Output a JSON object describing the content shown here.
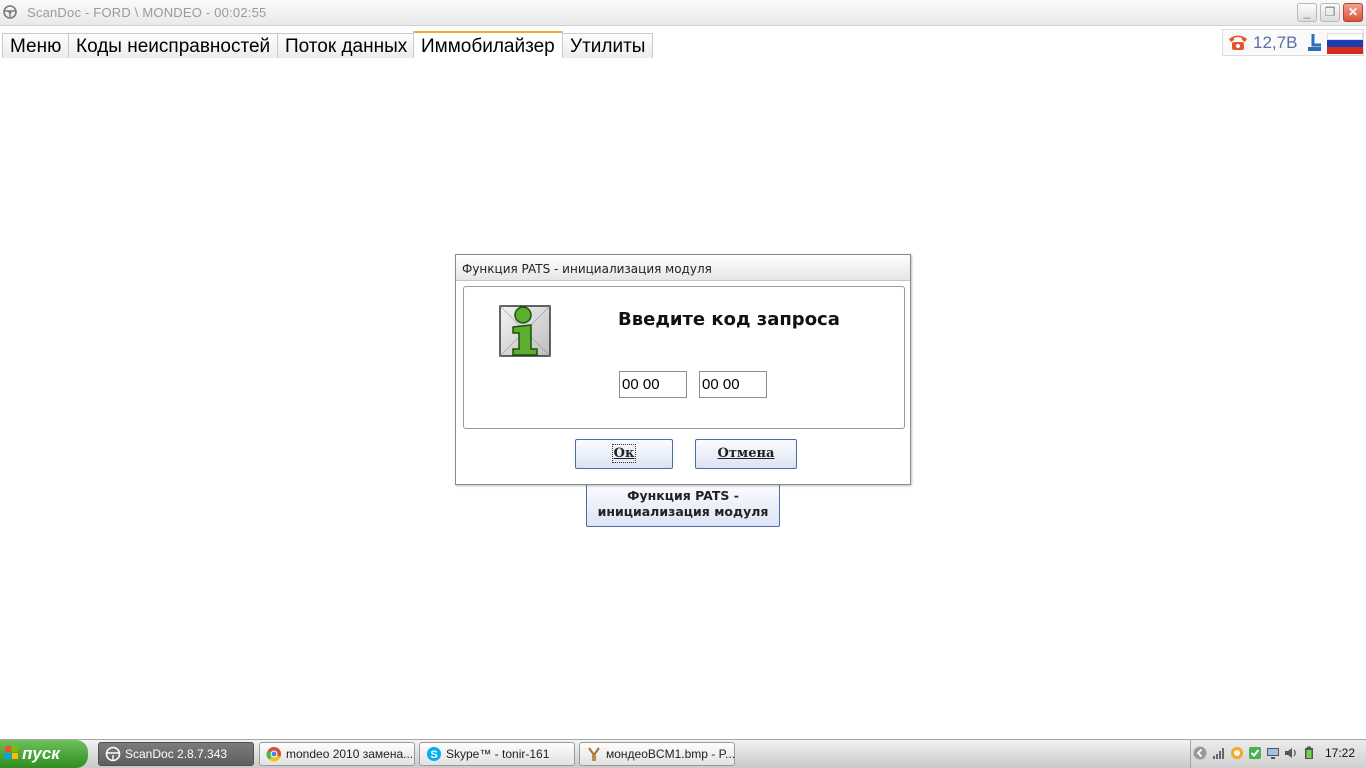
{
  "window": {
    "title": "ScanDoc - FORD \\ MONDEO - 00:02:55",
    "minimize": "_",
    "restore": "❐",
    "close": "✕"
  },
  "tabs": [
    {
      "label": "Меню"
    },
    {
      "label": "Коды неисправностей"
    },
    {
      "label": "Поток данных"
    },
    {
      "label": "Иммобилайзер",
      "active": true
    },
    {
      "label": "Утилиты"
    }
  ],
  "status": {
    "voltage": "12,7В",
    "icons": [
      "phone-icon",
      "plug-icon",
      "russian-flag-icon"
    ]
  },
  "background_button": {
    "line1": "Функция PATS -",
    "line2": "инициализация модуля"
  },
  "dialog": {
    "title": "Функция PATS - инициализация модуля",
    "prompt": "Введите код запроса",
    "code1": "00 00",
    "code2": "00 00",
    "ok_label": "Ок",
    "cancel_label": "Отмена"
  },
  "taskbar": {
    "start_label": "пуск",
    "tasks": [
      {
        "label": "ScanDoc 2.8.7.343",
        "icon": "steering-wheel-icon",
        "active": true
      },
      {
        "label": "mondeo 2010 замена...",
        "icon": "chrome-icon"
      },
      {
        "label": "Skype™ - tonir-161",
        "icon": "skype-icon"
      },
      {
        "label": "мондеоBCM1.bmp - P...",
        "icon": "paint-icon"
      }
    ],
    "clock": "17:22"
  },
  "colors": {
    "tab_active_accent": "#f3a732",
    "start_green": "#3a9a2b",
    "button_border": "#4b6ea8",
    "voltage_text": "#5c6ea8"
  }
}
